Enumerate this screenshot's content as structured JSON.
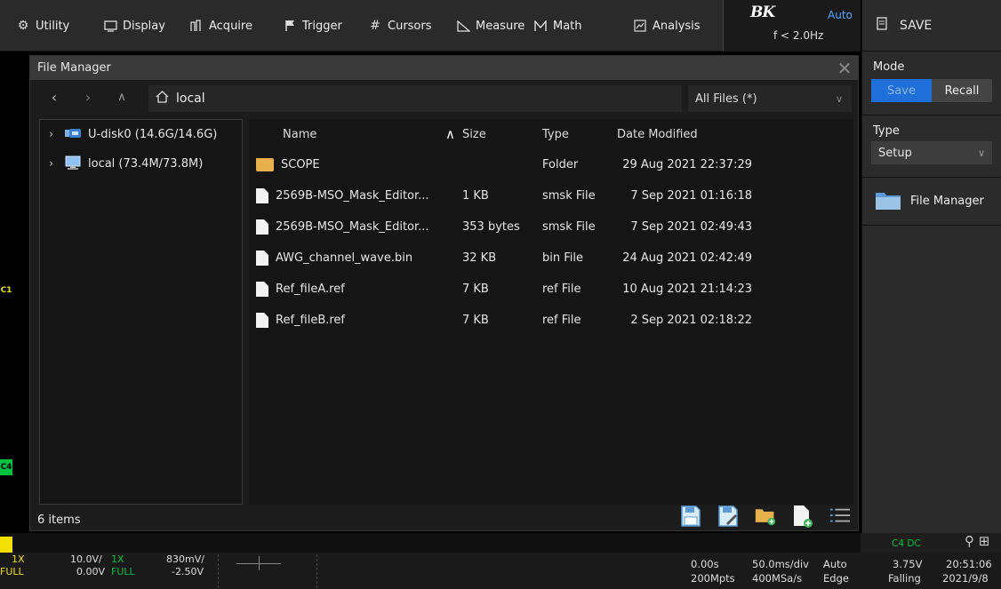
{
  "menu": {
    "items": [
      {
        "label": "Utility",
        "icon": "gear-icon"
      },
      {
        "label": "Display",
        "icon": "monitor-icon"
      },
      {
        "label": "Acquire",
        "icon": "acquire-icon"
      },
      {
        "label": "Trigger",
        "icon": "flag-icon"
      },
      {
        "label": "Cursors",
        "icon": "cursors-icon"
      },
      {
        "label": "Measure",
        "icon": "measure-icon"
      },
      {
        "label": "Math",
        "icon": "math-icon"
      },
      {
        "label": "Analysis",
        "icon": "analysis-icon"
      }
    ]
  },
  "trigger_status": {
    "logo": "BK",
    "mode": "Auto",
    "freq": "f < 2.0Hz"
  },
  "right_panel": {
    "title": "SAVE",
    "mode_label": "Mode",
    "mode_options": [
      "Save",
      "Recall"
    ],
    "mode_selected": "Save",
    "type_label": "Type",
    "type_value": "Setup",
    "file_manager_label": "File Manager"
  },
  "channel_markers": {
    "c1": "C1",
    "c4": "C4"
  },
  "dialog": {
    "title": "File Manager",
    "path": "local",
    "filter": "All Files (*)",
    "tree": [
      {
        "label": "U-disk0 (14.6G/14.6G)",
        "icon": "usb-drive-icon"
      },
      {
        "label": "local (73.4M/73.8M)",
        "icon": "local-drive-icon"
      }
    ],
    "columns": {
      "name": "Name",
      "size": "Size",
      "type": "Type",
      "date": "Date Modified"
    },
    "files": [
      {
        "name": "SCOPE",
        "size": "",
        "type": "Folder",
        "date": "29 Aug 2021 22:37:29",
        "kind": "folder"
      },
      {
        "name": "2569B-MSO_Mask_Editor...",
        "size": "1 KB",
        "type": "smsk File",
        "date": "7 Sep 2021 01:16:18",
        "kind": "file"
      },
      {
        "name": "2569B-MSO_Mask_Editor...",
        "size": "353 bytes",
        "type": "smsk File",
        "date": "7 Sep 2021 02:49:43",
        "kind": "file"
      },
      {
        "name": "AWG_channel_wave.bin",
        "size": "32 KB",
        "type": "bin File",
        "date": "24 Aug 2021 02:42:49",
        "kind": "file"
      },
      {
        "name": "Ref_fileA.ref",
        "size": "7 KB",
        "type": "ref File",
        "date": "10 Aug 2021 21:14:23",
        "kind": "file"
      },
      {
        "name": "Ref_fileB.ref",
        "size": "7 KB",
        "type": "ref File",
        "date": "2 Sep 2021 02:18:22",
        "kind": "file"
      }
    ],
    "item_count": "6 items"
  },
  "bottom": {
    "ch1": {
      "probe": "1X",
      "scale": "10.0V/",
      "mode": "FULL",
      "offset": "0.00V"
    },
    "ch2": {
      "probe": "1X",
      "scale": "830mV/",
      "mode": "FULL",
      "offset": "-2.50V"
    },
    "timebase": {
      "delay": "0.00s",
      "scale": "50.0ms/div",
      "mode": "Auto",
      "depth": "200Mpts",
      "rate": "400MSa/s",
      "type": "Edge"
    },
    "trigger": {
      "source": "C4 DC",
      "level": "3.75V",
      "slope": "Falling"
    },
    "clock": {
      "time": "20:51:06",
      "date": "2021/9/8"
    }
  },
  "colors": {
    "accent": "#1e6fd9",
    "ch1": "#f2e100",
    "ch4": "#00c040"
  }
}
